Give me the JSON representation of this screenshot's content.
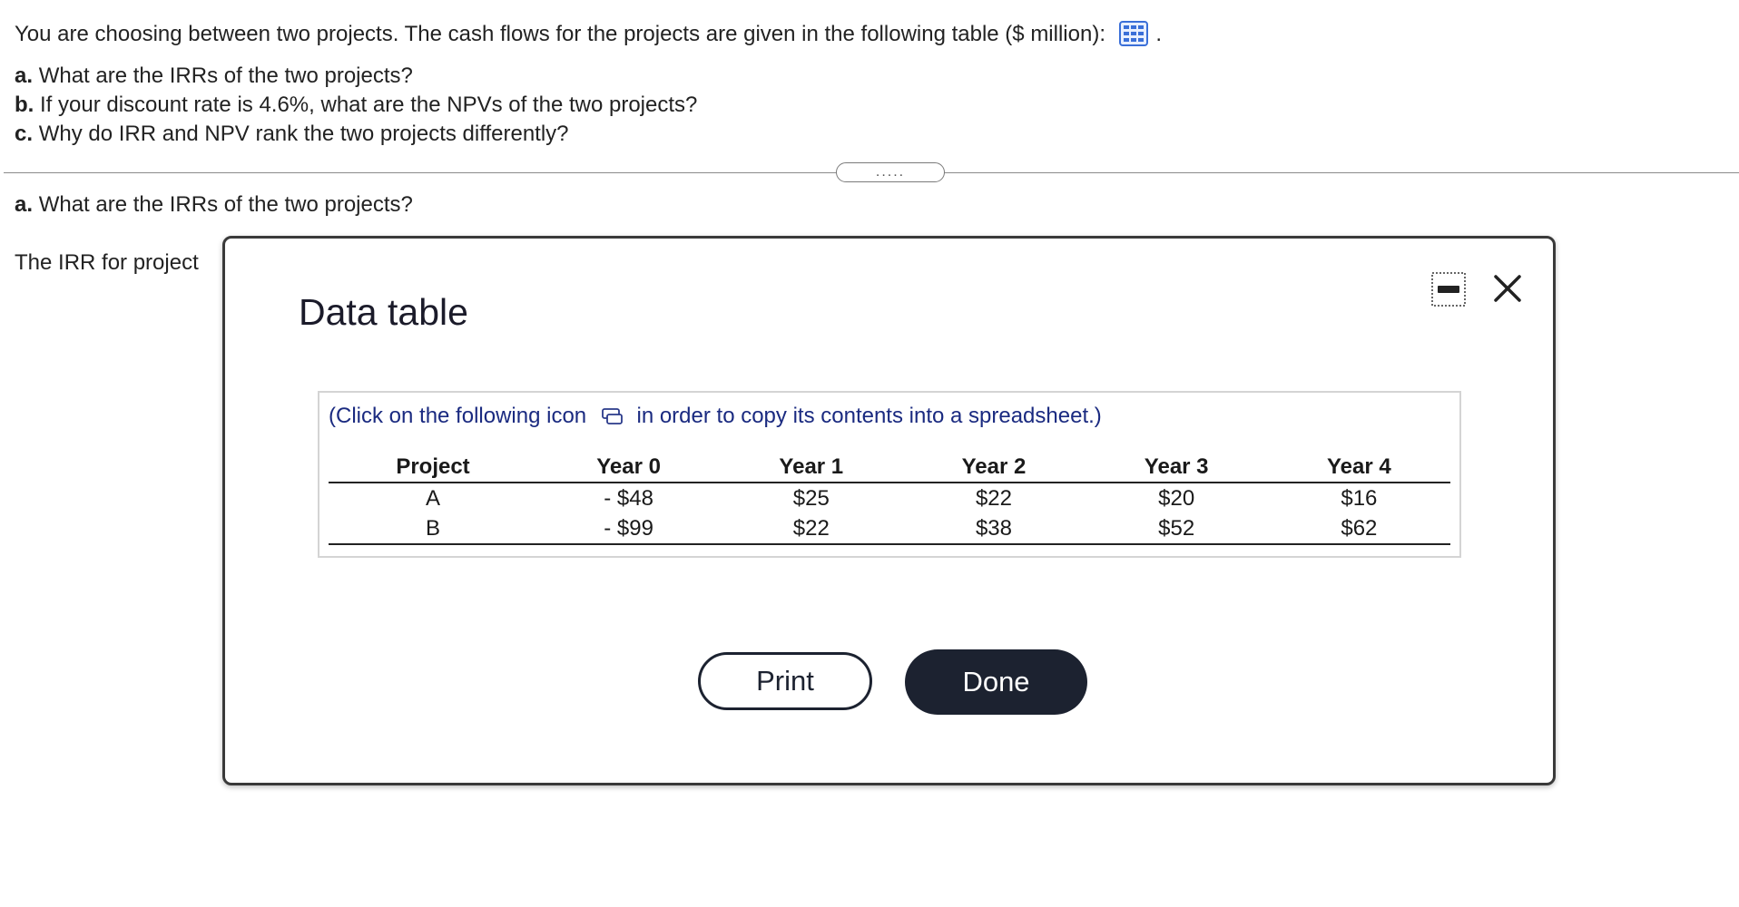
{
  "question": {
    "intro": "You are choosing between two projects. The cash flows for the projects are given in the following table ($ million):",
    "intro_suffix": ".",
    "parts": [
      {
        "label": "a.",
        "text": "What are the IRRs of the two projects?"
      },
      {
        "label": "b.",
        "text": "If your discount rate is 4.6%, what are the NPVs of the two projects?"
      },
      {
        "label": "c.",
        "text": "Why do IRR and NPV rank the two projects differently?"
      }
    ]
  },
  "expander": {
    "label": "....."
  },
  "answer_section": {
    "label": "a.",
    "text": "What are the IRRs of the two projects?",
    "irr_prompt": "The IRR for project"
  },
  "modal": {
    "title": "Data table",
    "copy_note_before": "(Click on the following icon",
    "copy_note_after": "in order to copy its contents into a spreadsheet.)",
    "table": {
      "headers": [
        "Project",
        "Year 0",
        "Year 1",
        "Year 2",
        "Year 3",
        "Year 4"
      ],
      "rows": [
        [
          "A",
          "- $48",
          "$25",
          "$22",
          "$20",
          "$16"
        ],
        [
          "B",
          "- $99",
          "$22",
          "$38",
          "$52",
          "$62"
        ]
      ]
    },
    "print_label": "Print",
    "done_label": "Done"
  },
  "colors": {
    "accent_dark": "#1c2230",
    "note_blue": "#1a2a80",
    "table_icon_blue": "#3a6fd8"
  },
  "icons": {
    "table": "table-grid-icon",
    "copy": "copy-to-spreadsheet-icon",
    "minimize": "minimize-icon",
    "close": "close-icon"
  }
}
